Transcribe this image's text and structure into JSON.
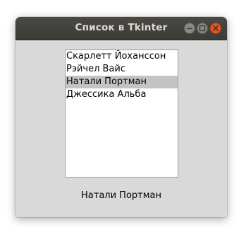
{
  "window": {
    "title": "Список в Tkinter",
    "buttons": {
      "minimize": "minimize-icon",
      "maximize": "maximize-icon",
      "close": "close-icon"
    }
  },
  "listbox": {
    "items": [
      "Скарлетт Йоханссон",
      "Рэйчел Вайс",
      "Натали Портман",
      "Джессика Альба"
    ],
    "selected_index": 2
  },
  "label": {
    "text": "Натали Портман"
  },
  "colors": {
    "titlebar": "#3c3b37",
    "close_button": "#e95420",
    "window_bg": "#d9d9d9",
    "selection": "#c3c3c3"
  }
}
